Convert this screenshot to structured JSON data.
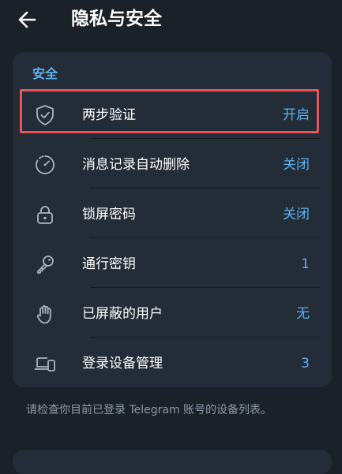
{
  "header": {
    "back_icon": "arrow-left-icon",
    "title": "隐私与安全"
  },
  "security": {
    "section_title": "安全",
    "items": [
      {
        "icon": "shield-check-icon",
        "label": "两步验证",
        "value": "开启"
      },
      {
        "icon": "timer-icon",
        "label": "消息记录自动删除",
        "value": "关闭"
      },
      {
        "icon": "lock-icon",
        "label": "锁屏密码",
        "value": "关闭"
      },
      {
        "icon": "key-icon",
        "label": "通行密钥",
        "value": "1"
      },
      {
        "icon": "hand-icon",
        "label": "已屏蔽的用户",
        "value": "无"
      },
      {
        "icon": "devices-icon",
        "label": "登录设备管理",
        "value": "3"
      }
    ],
    "footnote": "请检查你目前已登录 Telegram 账号的设备列表。"
  },
  "colors": {
    "background": "#1b2129",
    "card": "#232c37",
    "accent": "#5eb1f0",
    "highlight": "#e8555a",
    "secondary_text": "#8d98a6"
  }
}
